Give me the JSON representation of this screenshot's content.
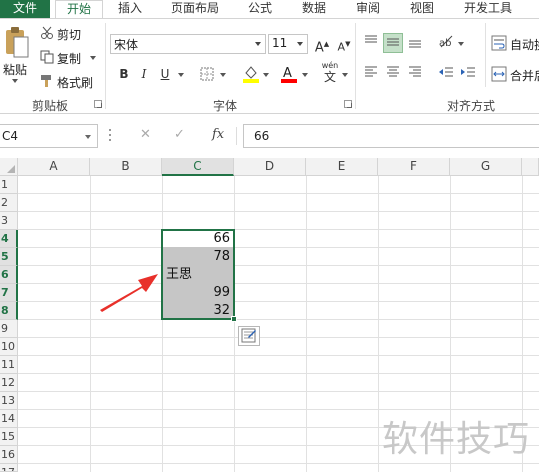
{
  "ribbon": {
    "tabs": [
      "文件",
      "开始",
      "插入",
      "页面布局",
      "公式",
      "数据",
      "审阅",
      "视图",
      "开发工具"
    ],
    "active_tab": "开始",
    "clipboard": {
      "paste_label": "粘贴",
      "cut_label": "剪切",
      "copy_label": "复制",
      "format_painter_label": "格式刷",
      "group_label": "剪贴板"
    },
    "font": {
      "font_name": "宋体",
      "font_size": "11",
      "bold": "B",
      "italic": "I",
      "underline": "U",
      "wen": "wén",
      "wen_char": "文",
      "group_label": "字体",
      "fill_color": "#ffff00",
      "font_color": "#ff0000"
    },
    "alignment": {
      "wrap_text_label": "自动换",
      "merge_label": "合并后",
      "group_label": "对齐方式"
    }
  },
  "formula_bar": {
    "name_box": "C4",
    "fx_label": "fx",
    "value": "66"
  },
  "sheet": {
    "columns": [
      "A",
      "B",
      "C",
      "D",
      "E",
      "F",
      "G"
    ],
    "selected_column": "C",
    "rows": [
      "1",
      "2",
      "3",
      "4",
      "5",
      "6",
      "7",
      "8",
      "9",
      "10",
      "11",
      "12",
      "13",
      "14",
      "15",
      "16",
      "17"
    ],
    "selected_rows": [
      "4",
      "5",
      "6",
      "7",
      "8"
    ],
    "cells": {
      "C4": "66",
      "C5": "78",
      "C6": "王思",
      "C7": "99",
      "C8": "32"
    },
    "accent_color": "#217346"
  },
  "watermark": "软件技巧"
}
